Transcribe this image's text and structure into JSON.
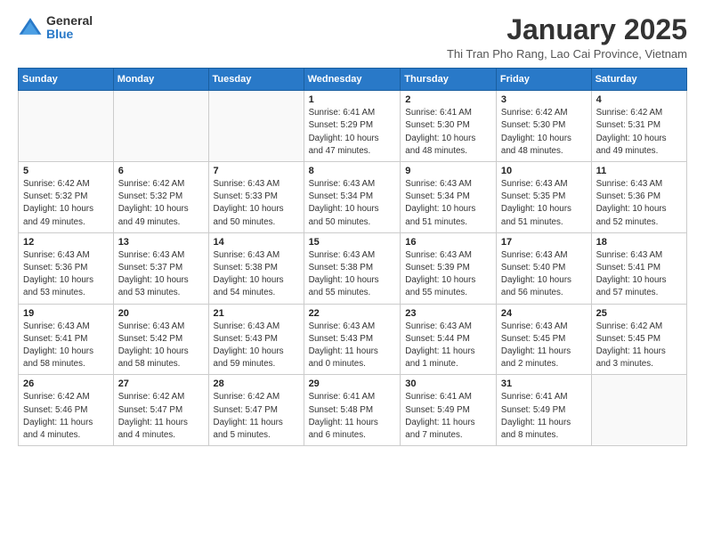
{
  "logo": {
    "general": "General",
    "blue": "Blue"
  },
  "title": "January 2025",
  "subtitle": "Thi Tran Pho Rang, Lao Cai Province, Vietnam",
  "days_of_week": [
    "Sunday",
    "Monday",
    "Tuesday",
    "Wednesday",
    "Thursday",
    "Friday",
    "Saturday"
  ],
  "weeks": [
    [
      {
        "day": "",
        "info": ""
      },
      {
        "day": "",
        "info": ""
      },
      {
        "day": "",
        "info": ""
      },
      {
        "day": "1",
        "info": "Sunrise: 6:41 AM\nSunset: 5:29 PM\nDaylight: 10 hours\nand 47 minutes."
      },
      {
        "day": "2",
        "info": "Sunrise: 6:41 AM\nSunset: 5:30 PM\nDaylight: 10 hours\nand 48 minutes."
      },
      {
        "day": "3",
        "info": "Sunrise: 6:42 AM\nSunset: 5:30 PM\nDaylight: 10 hours\nand 48 minutes."
      },
      {
        "day": "4",
        "info": "Sunrise: 6:42 AM\nSunset: 5:31 PM\nDaylight: 10 hours\nand 49 minutes."
      }
    ],
    [
      {
        "day": "5",
        "info": "Sunrise: 6:42 AM\nSunset: 5:32 PM\nDaylight: 10 hours\nand 49 minutes."
      },
      {
        "day": "6",
        "info": "Sunrise: 6:42 AM\nSunset: 5:32 PM\nDaylight: 10 hours\nand 49 minutes."
      },
      {
        "day": "7",
        "info": "Sunrise: 6:43 AM\nSunset: 5:33 PM\nDaylight: 10 hours\nand 50 minutes."
      },
      {
        "day": "8",
        "info": "Sunrise: 6:43 AM\nSunset: 5:34 PM\nDaylight: 10 hours\nand 50 minutes."
      },
      {
        "day": "9",
        "info": "Sunrise: 6:43 AM\nSunset: 5:34 PM\nDaylight: 10 hours\nand 51 minutes."
      },
      {
        "day": "10",
        "info": "Sunrise: 6:43 AM\nSunset: 5:35 PM\nDaylight: 10 hours\nand 51 minutes."
      },
      {
        "day": "11",
        "info": "Sunrise: 6:43 AM\nSunset: 5:36 PM\nDaylight: 10 hours\nand 52 minutes."
      }
    ],
    [
      {
        "day": "12",
        "info": "Sunrise: 6:43 AM\nSunset: 5:36 PM\nDaylight: 10 hours\nand 53 minutes."
      },
      {
        "day": "13",
        "info": "Sunrise: 6:43 AM\nSunset: 5:37 PM\nDaylight: 10 hours\nand 53 minutes."
      },
      {
        "day": "14",
        "info": "Sunrise: 6:43 AM\nSunset: 5:38 PM\nDaylight: 10 hours\nand 54 minutes."
      },
      {
        "day": "15",
        "info": "Sunrise: 6:43 AM\nSunset: 5:38 PM\nDaylight: 10 hours\nand 55 minutes."
      },
      {
        "day": "16",
        "info": "Sunrise: 6:43 AM\nSunset: 5:39 PM\nDaylight: 10 hours\nand 55 minutes."
      },
      {
        "day": "17",
        "info": "Sunrise: 6:43 AM\nSunset: 5:40 PM\nDaylight: 10 hours\nand 56 minutes."
      },
      {
        "day": "18",
        "info": "Sunrise: 6:43 AM\nSunset: 5:41 PM\nDaylight: 10 hours\nand 57 minutes."
      }
    ],
    [
      {
        "day": "19",
        "info": "Sunrise: 6:43 AM\nSunset: 5:41 PM\nDaylight: 10 hours\nand 58 minutes."
      },
      {
        "day": "20",
        "info": "Sunrise: 6:43 AM\nSunset: 5:42 PM\nDaylight: 10 hours\nand 58 minutes."
      },
      {
        "day": "21",
        "info": "Sunrise: 6:43 AM\nSunset: 5:43 PM\nDaylight: 10 hours\nand 59 minutes."
      },
      {
        "day": "22",
        "info": "Sunrise: 6:43 AM\nSunset: 5:43 PM\nDaylight: 11 hours\nand 0 minutes."
      },
      {
        "day": "23",
        "info": "Sunrise: 6:43 AM\nSunset: 5:44 PM\nDaylight: 11 hours\nand 1 minute."
      },
      {
        "day": "24",
        "info": "Sunrise: 6:43 AM\nSunset: 5:45 PM\nDaylight: 11 hours\nand 2 minutes."
      },
      {
        "day": "25",
        "info": "Sunrise: 6:42 AM\nSunset: 5:45 PM\nDaylight: 11 hours\nand 3 minutes."
      }
    ],
    [
      {
        "day": "26",
        "info": "Sunrise: 6:42 AM\nSunset: 5:46 PM\nDaylight: 11 hours\nand 4 minutes."
      },
      {
        "day": "27",
        "info": "Sunrise: 6:42 AM\nSunset: 5:47 PM\nDaylight: 11 hours\nand 4 minutes."
      },
      {
        "day": "28",
        "info": "Sunrise: 6:42 AM\nSunset: 5:47 PM\nDaylight: 11 hours\nand 5 minutes."
      },
      {
        "day": "29",
        "info": "Sunrise: 6:41 AM\nSunset: 5:48 PM\nDaylight: 11 hours\nand 6 minutes."
      },
      {
        "day": "30",
        "info": "Sunrise: 6:41 AM\nSunset: 5:49 PM\nDaylight: 11 hours\nand 7 minutes."
      },
      {
        "day": "31",
        "info": "Sunrise: 6:41 AM\nSunset: 5:49 PM\nDaylight: 11 hours\nand 8 minutes."
      },
      {
        "day": "",
        "info": ""
      }
    ]
  ]
}
